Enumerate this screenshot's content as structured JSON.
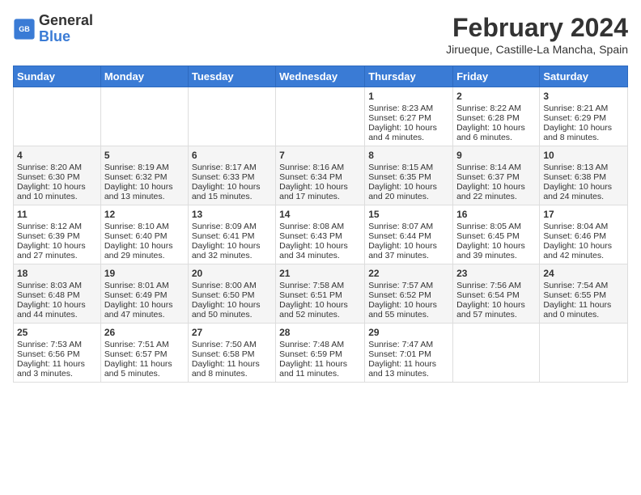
{
  "header": {
    "logo": {
      "line1": "General",
      "line2": "Blue"
    },
    "title": "February 2024",
    "subtitle": "Jirueque, Castille-La Mancha, Spain"
  },
  "weekdays": [
    "Sunday",
    "Monday",
    "Tuesday",
    "Wednesday",
    "Thursday",
    "Friday",
    "Saturday"
  ],
  "weeks": [
    [
      {
        "day": "",
        "data": ""
      },
      {
        "day": "",
        "data": ""
      },
      {
        "day": "",
        "data": ""
      },
      {
        "day": "",
        "data": ""
      },
      {
        "day": "1",
        "data": "Sunrise: 8:23 AM\nSunset: 6:27 PM\nDaylight: 10 hours and 4 minutes."
      },
      {
        "day": "2",
        "data": "Sunrise: 8:22 AM\nSunset: 6:28 PM\nDaylight: 10 hours and 6 minutes."
      },
      {
        "day": "3",
        "data": "Sunrise: 8:21 AM\nSunset: 6:29 PM\nDaylight: 10 hours and 8 minutes."
      }
    ],
    [
      {
        "day": "4",
        "data": "Sunrise: 8:20 AM\nSunset: 6:30 PM\nDaylight: 10 hours and 10 minutes."
      },
      {
        "day": "5",
        "data": "Sunrise: 8:19 AM\nSunset: 6:32 PM\nDaylight: 10 hours and 13 minutes."
      },
      {
        "day": "6",
        "data": "Sunrise: 8:17 AM\nSunset: 6:33 PM\nDaylight: 10 hours and 15 minutes."
      },
      {
        "day": "7",
        "data": "Sunrise: 8:16 AM\nSunset: 6:34 PM\nDaylight: 10 hours and 17 minutes."
      },
      {
        "day": "8",
        "data": "Sunrise: 8:15 AM\nSunset: 6:35 PM\nDaylight: 10 hours and 20 minutes."
      },
      {
        "day": "9",
        "data": "Sunrise: 8:14 AM\nSunset: 6:37 PM\nDaylight: 10 hours and 22 minutes."
      },
      {
        "day": "10",
        "data": "Sunrise: 8:13 AM\nSunset: 6:38 PM\nDaylight: 10 hours and 24 minutes."
      }
    ],
    [
      {
        "day": "11",
        "data": "Sunrise: 8:12 AM\nSunset: 6:39 PM\nDaylight: 10 hours and 27 minutes."
      },
      {
        "day": "12",
        "data": "Sunrise: 8:10 AM\nSunset: 6:40 PM\nDaylight: 10 hours and 29 minutes."
      },
      {
        "day": "13",
        "data": "Sunrise: 8:09 AM\nSunset: 6:41 PM\nDaylight: 10 hours and 32 minutes."
      },
      {
        "day": "14",
        "data": "Sunrise: 8:08 AM\nSunset: 6:43 PM\nDaylight: 10 hours and 34 minutes."
      },
      {
        "day": "15",
        "data": "Sunrise: 8:07 AM\nSunset: 6:44 PM\nDaylight: 10 hours and 37 minutes."
      },
      {
        "day": "16",
        "data": "Sunrise: 8:05 AM\nSunset: 6:45 PM\nDaylight: 10 hours and 39 minutes."
      },
      {
        "day": "17",
        "data": "Sunrise: 8:04 AM\nSunset: 6:46 PM\nDaylight: 10 hours and 42 minutes."
      }
    ],
    [
      {
        "day": "18",
        "data": "Sunrise: 8:03 AM\nSunset: 6:48 PM\nDaylight: 10 hours and 44 minutes."
      },
      {
        "day": "19",
        "data": "Sunrise: 8:01 AM\nSunset: 6:49 PM\nDaylight: 10 hours and 47 minutes."
      },
      {
        "day": "20",
        "data": "Sunrise: 8:00 AM\nSunset: 6:50 PM\nDaylight: 10 hours and 50 minutes."
      },
      {
        "day": "21",
        "data": "Sunrise: 7:58 AM\nSunset: 6:51 PM\nDaylight: 10 hours and 52 minutes."
      },
      {
        "day": "22",
        "data": "Sunrise: 7:57 AM\nSunset: 6:52 PM\nDaylight: 10 hours and 55 minutes."
      },
      {
        "day": "23",
        "data": "Sunrise: 7:56 AM\nSunset: 6:54 PM\nDaylight: 10 hours and 57 minutes."
      },
      {
        "day": "24",
        "data": "Sunrise: 7:54 AM\nSunset: 6:55 PM\nDaylight: 11 hours and 0 minutes."
      }
    ],
    [
      {
        "day": "25",
        "data": "Sunrise: 7:53 AM\nSunset: 6:56 PM\nDaylight: 11 hours and 3 minutes."
      },
      {
        "day": "26",
        "data": "Sunrise: 7:51 AM\nSunset: 6:57 PM\nDaylight: 11 hours and 5 minutes."
      },
      {
        "day": "27",
        "data": "Sunrise: 7:50 AM\nSunset: 6:58 PM\nDaylight: 11 hours and 8 minutes."
      },
      {
        "day": "28",
        "data": "Sunrise: 7:48 AM\nSunset: 6:59 PM\nDaylight: 11 hours and 11 minutes."
      },
      {
        "day": "29",
        "data": "Sunrise: 7:47 AM\nSunset: 7:01 PM\nDaylight: 11 hours and 13 minutes."
      },
      {
        "day": "",
        "data": ""
      },
      {
        "day": "",
        "data": ""
      }
    ]
  ]
}
